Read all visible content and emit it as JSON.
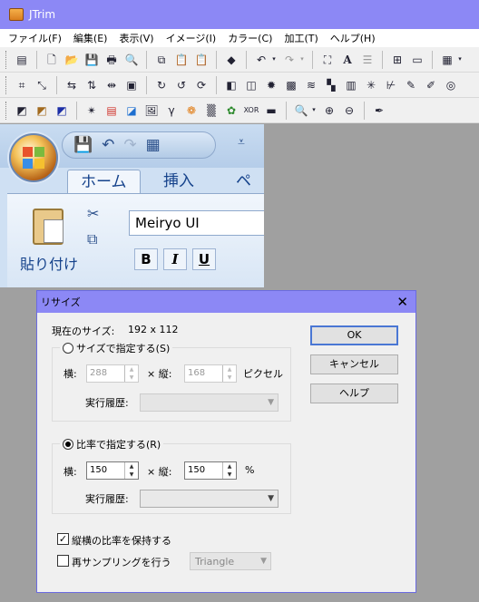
{
  "app": {
    "title": "JTrim"
  },
  "menu": [
    "ファイル(F)",
    "編集(E)",
    "表示(V)",
    "イメージ(I)",
    "カラー(C)",
    "加工(T)",
    "ヘルプ(H)"
  ],
  "preview": {
    "tab_home": "ホーム",
    "tab_insert": "挿入",
    "tab_page": "ペー",
    "paste_label": "貼り付け",
    "font_name": "Meiryo UI",
    "format_buttons": [
      "B",
      "I",
      "U"
    ]
  },
  "dialog": {
    "title": "リサイズ",
    "current_size_label": "現在のサイズ:",
    "current_size_value": "192 x 112",
    "size_group": {
      "label": "サイズで指定する(S)",
      "width_label": "横:",
      "width_value": "288",
      "times": "× 縦:",
      "height_value": "168",
      "unit": "ピクセル",
      "history_label": "実行履歴:"
    },
    "ratio_group": {
      "label": "比率で指定する(R)",
      "width_label": "横:",
      "width_value": "150",
      "times": "× 縦:",
      "height_value": "150",
      "unit": "%",
      "history_label": "実行履歴:"
    },
    "keep_ratio_label": "縦横の比率を保持する",
    "resample_label": "再サンプリングを行う",
    "resample_method": "Triangle",
    "ok": "OK",
    "cancel": "キャンセル",
    "help": "ヘルプ"
  }
}
